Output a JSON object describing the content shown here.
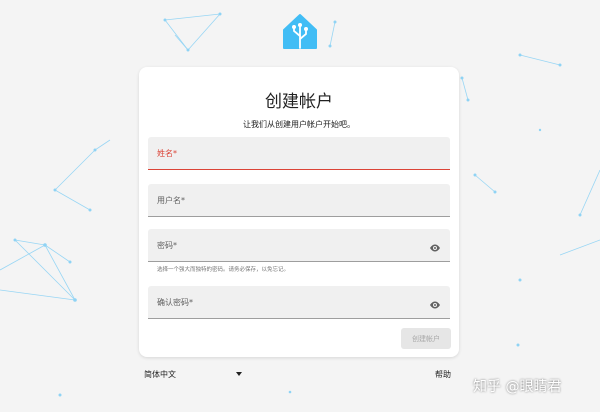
{
  "card": {
    "title": "创建帐户",
    "subtitle": "让我们从创建用户帐户开始吧。"
  },
  "fields": {
    "name": {
      "label": "姓名*",
      "state": "error"
    },
    "username": {
      "label": "用户名*"
    },
    "password": {
      "label": "密码*",
      "helper": "选择一个强大而独特的密码。请务必保存，以免忘记。"
    },
    "confirm_password": {
      "label": "确认密码*"
    }
  },
  "buttons": {
    "create_account": "创建帐户"
  },
  "footer": {
    "language": "简体中文",
    "help": "帮助"
  },
  "watermark": "知乎 @眼睛君",
  "icons": {
    "logo": "home-assistant-logo-icon",
    "eye": "eye-icon",
    "caret": "caret-down-icon"
  },
  "colors": {
    "brand": "#41bdf5",
    "error": "#db4437",
    "network": "#8fd3f4"
  }
}
